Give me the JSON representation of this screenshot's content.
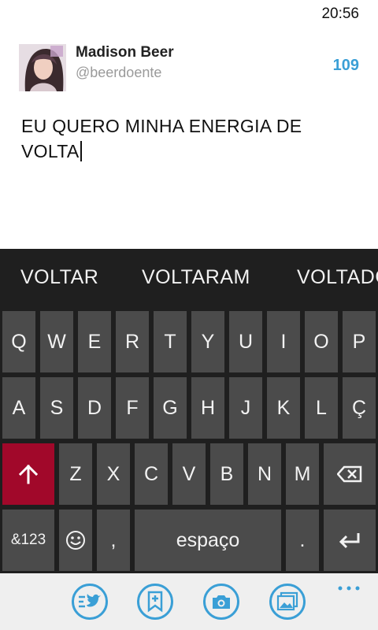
{
  "status": {
    "time": "20:56"
  },
  "account": {
    "name": "Madison Beer",
    "handle": "@beerdoente",
    "chars_left": "109"
  },
  "compose": {
    "text": "EU QUERO MINHA ENERGIA DE VOLTA"
  },
  "suggestions": [
    "VOLTAR",
    "VOLTARAM",
    "VOLTADO"
  ],
  "keyboard": {
    "row1": [
      "Q",
      "W",
      "E",
      "R",
      "T",
      "Y",
      "U",
      "I",
      "O",
      "P"
    ],
    "row2": [
      "A",
      "S",
      "D",
      "F",
      "G",
      "H",
      "J",
      "K",
      "L",
      "Ç"
    ],
    "row3": [
      "Z",
      "X",
      "C",
      "V",
      "B",
      "N",
      "M"
    ],
    "numbers_label": "&123",
    "comma": ",",
    "space_label": "espaço",
    "period": "."
  },
  "app_bar": {
    "icons": [
      "twitter-list-icon",
      "bookmark-add-icon",
      "camera-icon",
      "gallery-icon"
    ],
    "more_icon": "more-dots-icon"
  },
  "colors": {
    "accent": "#3a9fd6",
    "shift": "#a1082a",
    "key": "#4b4b4b",
    "keyboard_bg": "#1f1f1f"
  }
}
